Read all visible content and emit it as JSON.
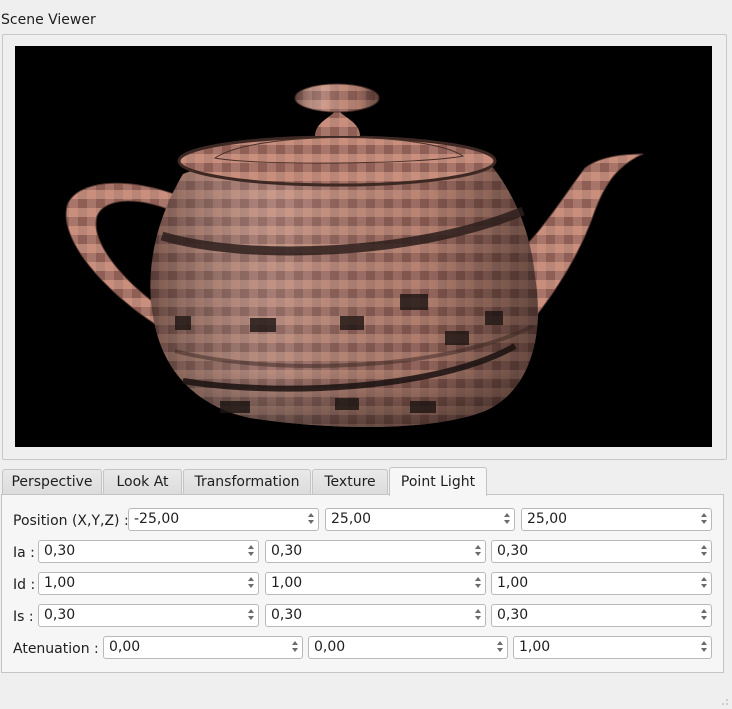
{
  "window": {
    "title": "Scene Viewer"
  },
  "tabs": [
    "Perspective",
    "Look At",
    "Transformation",
    "Texture",
    "Point Light"
  ],
  "active_tab": "Point Light",
  "point_light": {
    "position": {
      "label": "Position (X,Y,Z) :",
      "values": [
        "-25,00",
        "25,00",
        "25,00"
      ]
    },
    "ia": {
      "label": "Ia :",
      "values": [
        "0,30",
        "0,30",
        "0,30"
      ]
    },
    "id": {
      "label": "Id :",
      "values": [
        "1,00",
        "1,00",
        "1,00"
      ]
    },
    "is": {
      "label": "Is :",
      "values": [
        "0,30",
        "0,30",
        "0,30"
      ]
    },
    "atenuation": {
      "label": "Atenuation :",
      "values": [
        "0,00",
        "0,00",
        "1,00"
      ]
    }
  },
  "colors": {
    "viewport_bg": "#000000",
    "teapot_base": "#b07a6a",
    "window_bg": "#efefef"
  }
}
